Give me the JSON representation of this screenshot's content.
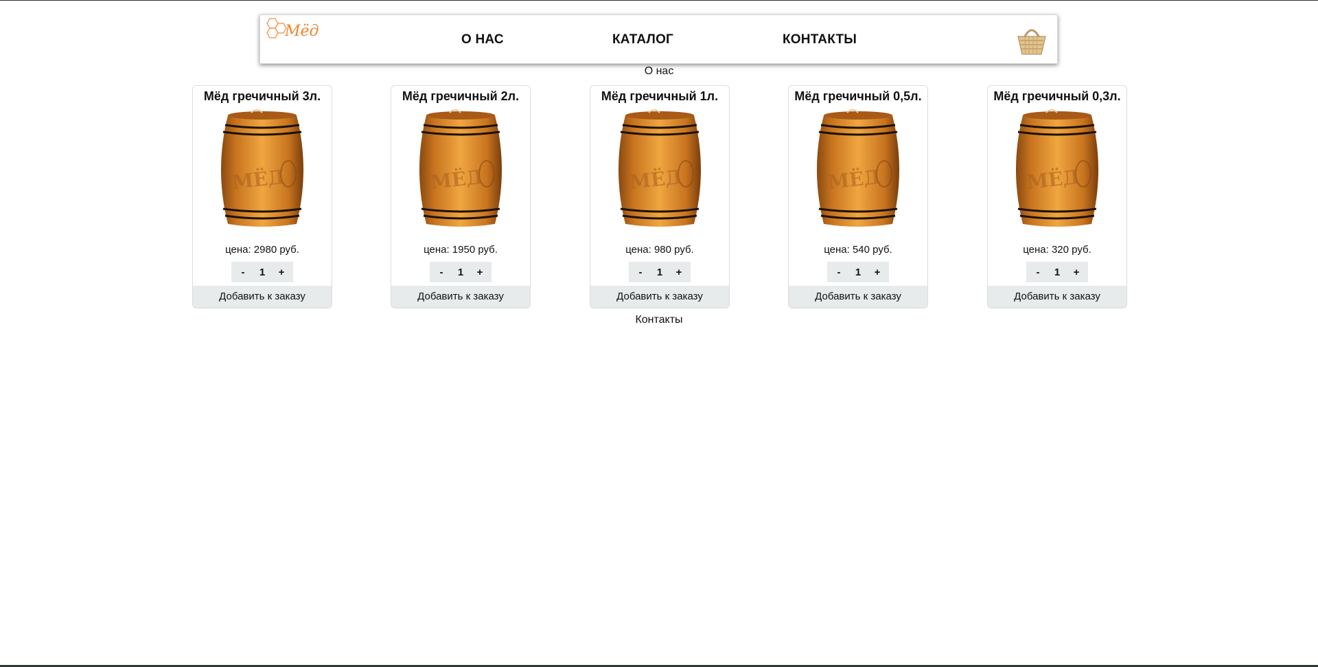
{
  "header": {
    "logo_text": "Мёд",
    "nav": [
      {
        "label": "О НАС"
      },
      {
        "label": "КАТАЛОГ"
      },
      {
        "label": "КОНТАКТЫ"
      }
    ],
    "basket_icon": "basket-icon"
  },
  "sections": {
    "about": "О нас",
    "contacts": "Контакты"
  },
  "products": [
    {
      "title": "Мёд гречичный 3л.",
      "price": "цена: 2980 руб.",
      "minus": "-",
      "qty": "1",
      "plus": "+",
      "add": "Добавить к заказу"
    },
    {
      "title": "Мёд гречичный 2л.",
      "price": "цена: 1950 руб.",
      "minus": "-",
      "qty": "1",
      "plus": "+",
      "add": "Добавить к заказу"
    },
    {
      "title": "Мёд гречичный 1л.",
      "price": "цена: 980 руб.",
      "minus": "-",
      "qty": "1",
      "plus": "+",
      "add": "Добавить к заказу"
    },
    {
      "title": "Мёд гречичный 0,5л.",
      "price": "цена: 540 руб.",
      "minus": "-",
      "qty": "1",
      "plus": "+",
      "add": "Добавить к заказу"
    },
    {
      "title": "Мёд гречичный 0,3л.",
      "price": "цена: 320 руб.",
      "minus": "-",
      "qty": "1",
      "plus": "+",
      "add": "Добавить к заказу"
    }
  ],
  "colors": {
    "accent": "#f0822a",
    "button_bg": "#e8ebeb",
    "barrel_wood": "#d98a2b"
  }
}
